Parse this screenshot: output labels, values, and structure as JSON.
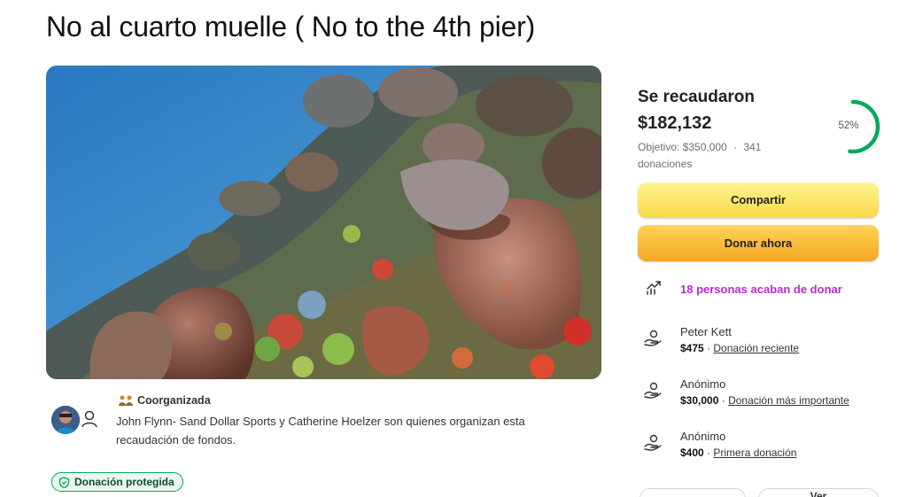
{
  "campaign": {
    "title": "No al cuarto muelle ( No to the 4th pier)"
  },
  "hero_image": {
    "alt_semantic": "coral-reef-photo"
  },
  "organizers": {
    "badge_label": "Coorganizada",
    "description": "John Flynn- Sand Dollar Sports y Catherine Hoelzer son quienes organizan esta recaudación de fondos."
  },
  "protection": {
    "label": "Donación protegida"
  },
  "progress": {
    "heading": "Se recaudaron",
    "amount": "$182,132",
    "goal_text": "Objetivo: $350,000",
    "separator": "·",
    "donations_text": "341 donaciones",
    "percent_label": "52%",
    "percent_value": 0.52,
    "ring_color": "#02a95c"
  },
  "actions": {
    "share_label": "Compartir",
    "donate_label": "Donar ahora"
  },
  "recent_activity": {
    "text": "18 personas acaban de donar",
    "color": "#b82ec6"
  },
  "donors": [
    {
      "name": "Peter Kett",
      "amount": "$475",
      "kind": "Donación reciente"
    },
    {
      "name": "Anónimo",
      "amount": "$30,000",
      "kind": "Donación más importante"
    },
    {
      "name": "Anónimo",
      "amount": "$400",
      "kind": "Primera donación"
    }
  ],
  "footer_buttons": {
    "see_label": "Ver"
  },
  "colors": {
    "accent_green": "#02a95c",
    "share_yellow": "#f7d947",
    "donate_orange": "#f5a623"
  }
}
